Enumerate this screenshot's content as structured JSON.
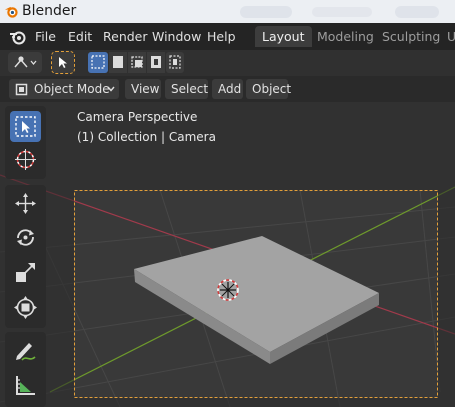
{
  "window": {
    "title": "Blender"
  },
  "menu": {
    "items": [
      "File",
      "Edit",
      "Render",
      "Window",
      "Help"
    ]
  },
  "workspaces": {
    "tabs": [
      "Layout",
      "Modeling",
      "Sculpting",
      "U"
    ],
    "active": "Layout"
  },
  "header": {
    "mode_label": "Object Mode",
    "menus": [
      "View",
      "Select",
      "Add",
      "Object"
    ]
  },
  "viewport": {
    "perspective_label": "Camera Perspective",
    "collection_label": "(1) Collection | Camera"
  },
  "tools": [
    "select-box-icon",
    "cursor-icon",
    "move-icon",
    "rotate-icon",
    "scale-icon",
    "transform-icon",
    "annotate-icon",
    "measure-icon"
  ],
  "colors": {
    "accent": "#4772b3",
    "camera_frame": "#e3a03a",
    "x_axis": "#a13a4b",
    "y_axis": "#6e9a2c",
    "object_surface": "#9b9b9b"
  }
}
